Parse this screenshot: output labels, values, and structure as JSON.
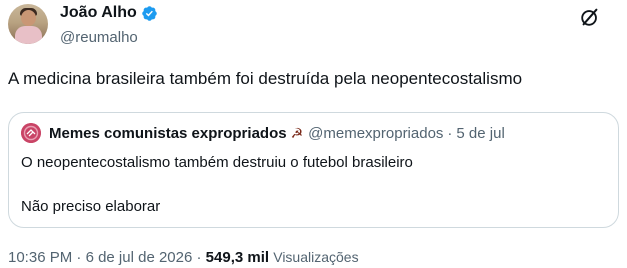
{
  "author": {
    "name": "João Alho",
    "handle": "@reumalho",
    "verified": true,
    "avatar_icon": "profile-photo",
    "verified_icon": "verified-badge-icon",
    "verified_color": "#1d9bf0"
  },
  "top_action_icon": "grok-icon",
  "tweet": {
    "text": "A medicina brasileira também foi destruída pela neopentecostalismo"
  },
  "quote": {
    "name": "Memes comunistas expropriados",
    "emoji": "☭",
    "handle": "@memexpropriados",
    "separator": "·",
    "date": "5 de jul",
    "line1": "O neopentecostalismo também destruiu o futebol brasileiro",
    "line2": "Não preciso elaborar"
  },
  "meta": {
    "time": "10:36 PM",
    "sep1": "·",
    "date": "6 de jul de 2026",
    "sep2": "·",
    "views_count": "549,3 mil",
    "views_label": "Visualizações"
  },
  "colors": {
    "text": "#0f1419",
    "secondary": "#536471",
    "border": "#cfd9de",
    "accent": "#1d9bf0"
  }
}
